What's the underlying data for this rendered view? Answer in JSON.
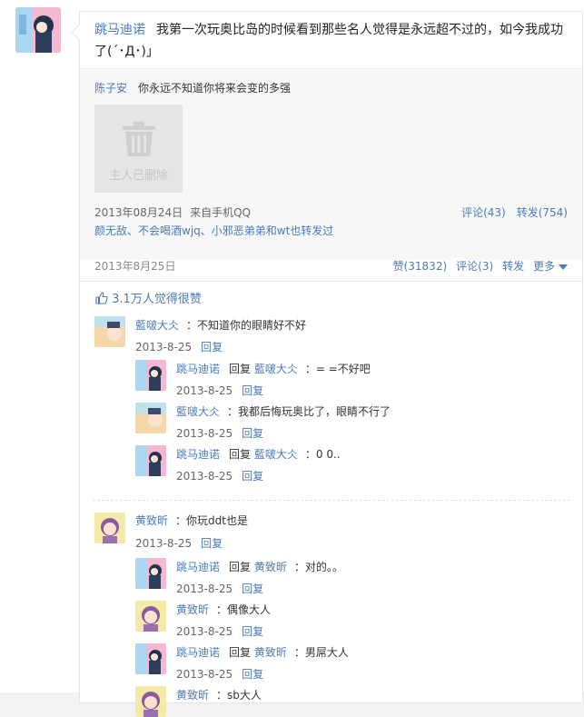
{
  "post": {
    "author": "跳马迪诺",
    "text": "我第一次玩奥比岛的时候看到那些名人觉得是永远超不过的，如今我成功了(´･Д･)」"
  },
  "repost": {
    "author": "陈子安",
    "text": "你永远不知道你将来会变的多强",
    "deleted_label": "主人已删除",
    "date": "2013年08月24日",
    "source": "来自手机QQ",
    "comment_label": "评论(43)",
    "forward_label": "转发(754)",
    "forwarders": "颜无敌、不会喝酒wjq、小邪恶弟弟和wt也转发过"
  },
  "footer": {
    "date": "2013年8月25日",
    "like_label": "赞(31832)",
    "comment_label": "评论(3)",
    "forward_label": "转发",
    "more_label": "更多"
  },
  "likes": {
    "label": "3.1万人觉得很赞"
  },
  "reply_label": "回复",
  "reply_word": "回复",
  "comments": [
    {
      "author": "藍啵大仌",
      "text": "：不知道你的眼睛好不好",
      "date": "2013-8-25"
    },
    {
      "author": "跳马迪诺",
      "reply_to": "藍啵大仌",
      "text": "：= =不好吧",
      "date": "2013-8-25"
    },
    {
      "author": "藍啵大仌",
      "text": "：我都后悔玩奥比了，眼睛不行了",
      "date": "2013-8-25"
    },
    {
      "author": "跳马迪诺",
      "reply_to": "藍啵大仌",
      "text": "：0 0..",
      "date": "2013-8-25"
    },
    {
      "author": "黄致昕",
      "text": "：你玩ddt也是",
      "date": "2013-8-25"
    },
    {
      "author": "跳马迪诺",
      "reply_to": "黄致昕",
      "text": "：对的。。",
      "date": "2013-8-25"
    },
    {
      "author": "黄致昕",
      "text": "：偶像大人",
      "date": "2013-8-25"
    },
    {
      "author": "跳马迪诺",
      "reply_to": "黄致昕",
      "text": "：男屌大人",
      "date": "2013-8-25"
    },
    {
      "author": "黄致昕",
      "text": "：sb大人",
      "date": ""
    }
  ],
  "colors": {
    "link": "#4a7ab6",
    "accent": "#2f7fc8"
  }
}
